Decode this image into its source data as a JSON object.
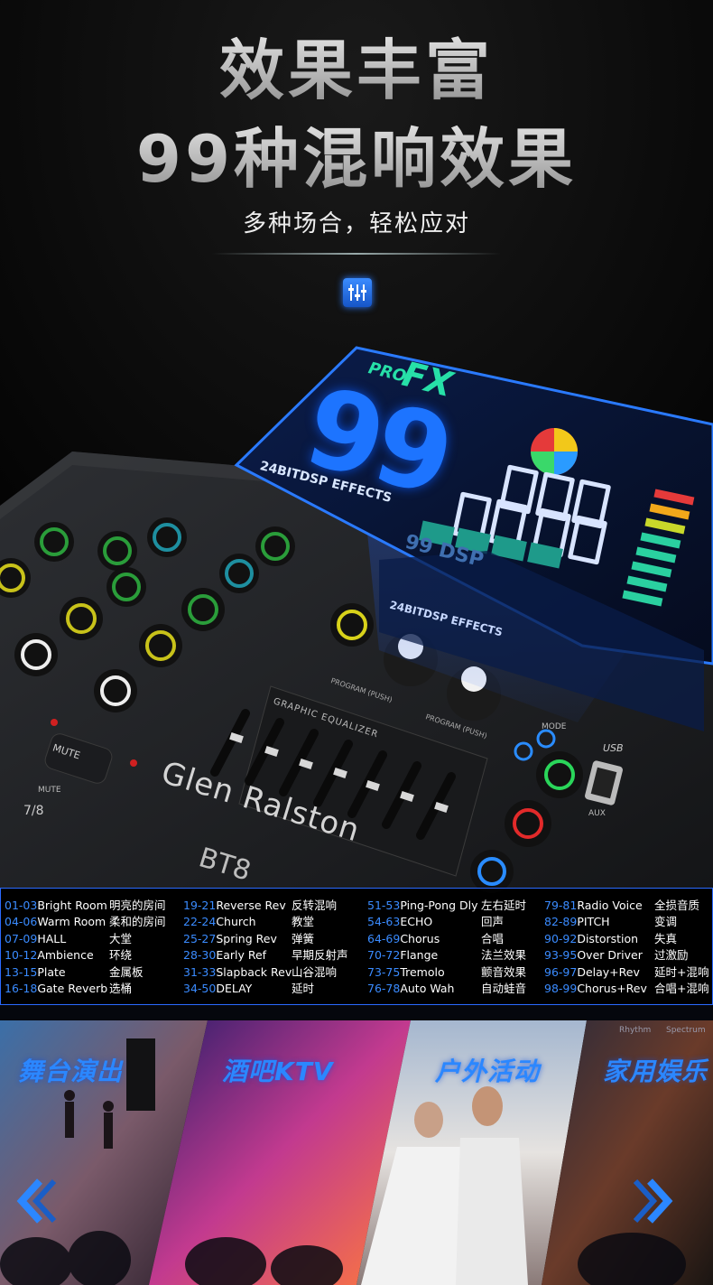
{
  "header": {
    "title_line1": "效果丰富",
    "title_line2": "99种混响效果",
    "subtitle": "多种场合，轻松应对"
  },
  "lcd": {
    "pro": "PRO",
    "fx": "FX",
    "effect_count": "99",
    "caption": "24BITDSP EFFECTS",
    "dsp_badge": "99 DSP",
    "reflect_caption": "24BITDSP EFFECTS"
  },
  "mixer": {
    "brand": "Glen Ralston",
    "model": "BT8",
    "geq_label": "GRAPHIC EQUALIZER",
    "mute_button": "MUTE",
    "mute_label": "MUTE",
    "channel_label": "7/8",
    "mode_label": "MODE",
    "usb_label": "USB",
    "aux_label": "AUX",
    "program_a": "PROGRAM (PUSH)",
    "program_b": "PROGRAM (PUSH)"
  },
  "effects": [
    [
      {
        "num": "01-03",
        "en": "Bright Room",
        "cn": "明亮的房间"
      },
      {
        "num": "04-06",
        "en": "Warm Room",
        "cn": "柔和的房间"
      },
      {
        "num": "07-09",
        "en": "HALL",
        "cn": "大堂"
      },
      {
        "num": "10-12",
        "en": "Ambience",
        "cn": "环绕"
      },
      {
        "num": "13-15",
        "en": "Plate",
        "cn": "金属板"
      },
      {
        "num": "16-18",
        "en": "Gate Reverb",
        "cn": "选桶"
      }
    ],
    [
      {
        "num": "19-21",
        "en": "Reverse Rev",
        "cn": "反转混响"
      },
      {
        "num": "22-24",
        "en": "Church",
        "cn": "教堂"
      },
      {
        "num": "25-27",
        "en": "Spring Rev",
        "cn": "弹簧"
      },
      {
        "num": "28-30",
        "en": "Early Ref",
        "cn": "早期反射声"
      },
      {
        "num": "31-33",
        "en": "Slapback Rev",
        "cn": "山谷混响"
      },
      {
        "num": "34-50",
        "en": "DELAY",
        "cn": "延时"
      }
    ],
    [
      {
        "num": "51-53",
        "en": "Ping-Pong Dly",
        "cn": "左右延时"
      },
      {
        "num": "54-63",
        "en": "ECHO",
        "cn": "回声"
      },
      {
        "num": "64-69",
        "en": "Chorus",
        "cn": "合唱"
      },
      {
        "num": "70-72",
        "en": "Flange",
        "cn": "法兰效果"
      },
      {
        "num": "73-75",
        "en": "Tremolo",
        "cn": "颤音效果"
      },
      {
        "num": "76-78",
        "en": "Auto Wah",
        "cn": "自动蛙音"
      }
    ],
    [
      {
        "num": "79-81",
        "en": "Radio Voice",
        "cn": "全损音质"
      },
      {
        "num": "82-89",
        "en": "PITCH",
        "cn": "变调"
      },
      {
        "num": "90-92",
        "en": "Distorstion",
        "cn": "失真"
      },
      {
        "num": "93-95",
        "en": "Over Driver",
        "cn": "过激励"
      },
      {
        "num": "96-97",
        "en": "Delay+Rev",
        "cn": "延时+混响"
      },
      {
        "num": "98-99",
        "en": "Chorus+Rev",
        "cn": "合唱+混响"
      }
    ]
  ],
  "scenes": {
    "stage": "舞台演出",
    "ktv": "酒吧KTV",
    "outdoor": "户外活动",
    "home": "家用娱乐"
  },
  "home_screen": {
    "tab_a": "Rhythm",
    "tab_b": "Spectrum"
  },
  "colors": {
    "accent": "#2b87ff",
    "lcd_blue": "#1d74ff",
    "lcd_green": "#27e0a8"
  }
}
